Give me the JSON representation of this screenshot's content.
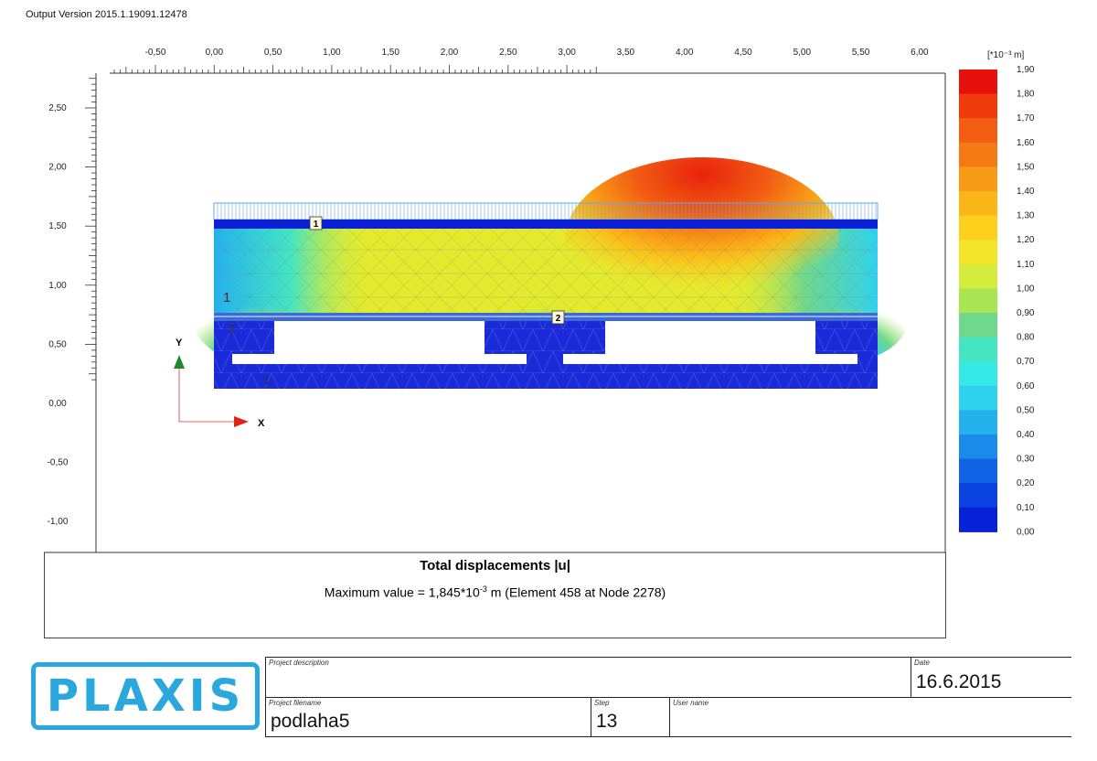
{
  "header": {
    "version": "Output Version 2015.1.19091.12478"
  },
  "axes": {
    "x_ticks": [
      "-0,50",
      "0,00",
      "0,50",
      "1,00",
      "1,50",
      "2,00",
      "2,50",
      "3,00",
      "3,50",
      "4,00",
      "4,50",
      "5,00",
      "5,50",
      "6,00"
    ],
    "y_ticks": [
      "2,50",
      "2,00",
      "1,50",
      "1,00",
      "0,50",
      "0,00",
      "-0,50",
      "-1,00"
    ],
    "x_axis_arrow_label": "X",
    "y_axis_arrow_label": "Y"
  },
  "legend": {
    "unit": "[*10⁻³ m]",
    "values": [
      "1,90",
      "1,80",
      "1,70",
      "1,60",
      "1,50",
      "1,40",
      "1,30",
      "1,20",
      "1,10",
      "1,00",
      "0,90",
      "0,80",
      "0,70",
      "0,60",
      "0,50",
      "0,40",
      "0,30",
      "0,20",
      "0,10",
      "0,00"
    ],
    "colors": [
      "#e8100c",
      "#ef3a0c",
      "#f25d12",
      "#f57a16",
      "#f89b18",
      "#fbb719",
      "#fdd01d",
      "#f2e52a",
      "#d5ec3c",
      "#a8e454",
      "#6fd88c",
      "#45e5c2",
      "#35e9e6",
      "#2fd2ee",
      "#25b1ee",
      "#1a8aeb",
      "#1163e6",
      "#0a43df",
      "#0522d8"
    ]
  },
  "model": {
    "labels": [
      "1",
      "2"
    ],
    "cluster_numbers": [
      "1",
      "2",
      "1"
    ]
  },
  "caption": {
    "title": "Total displacements |u|",
    "max_prefix": "Maximum value = 1,845*10",
    "max_exp": "-3",
    "max_suffix": " m (Element 458 at Node 2278)"
  },
  "footer": {
    "logo_text": "PLAXIS",
    "project_description_label": "Project description",
    "project_description_value": "",
    "date_label": "Date",
    "date_value": "16.6.2015",
    "project_filename_label": "Project filename",
    "project_filename_value": "podlaha5",
    "step_label": "Step",
    "step_value": "13",
    "user_name_label": "User name",
    "user_name_value": ""
  }
}
